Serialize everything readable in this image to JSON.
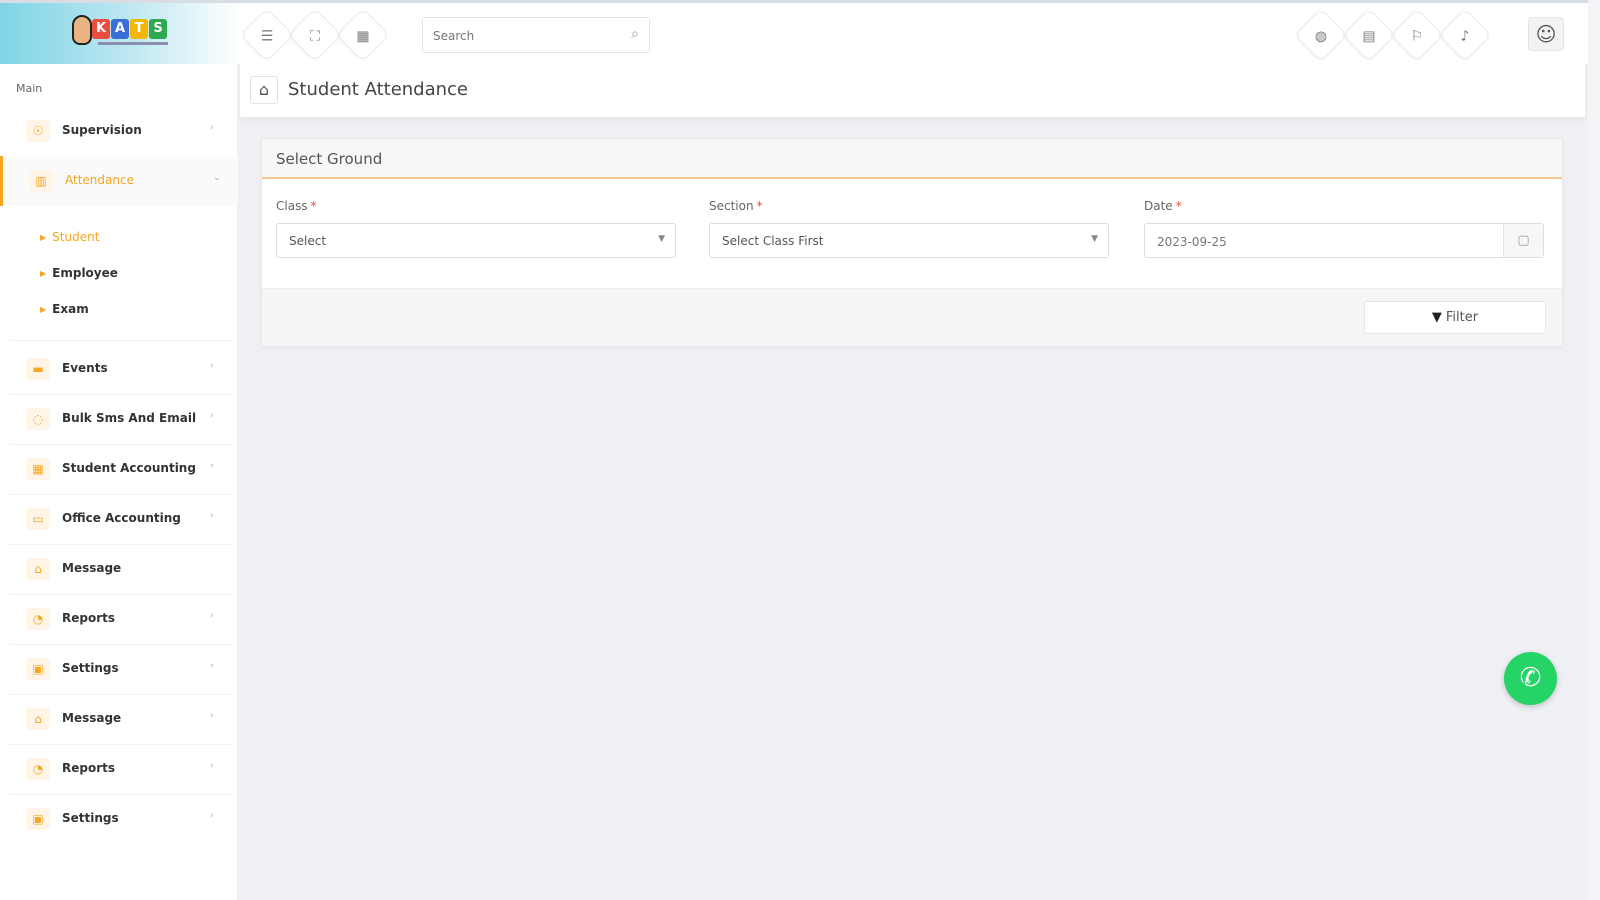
{
  "topbar": {
    "logo_letters": [
      "K",
      "A",
      "T",
      "S"
    ],
    "search_placeholder": "Search",
    "left_icons": [
      "menu-icon",
      "fullscreen-icon",
      "grid-icon"
    ],
    "right_icons": [
      "globe-icon",
      "calendar-icon",
      "flag-icon",
      "bell-icon"
    ],
    "avatar_icon": "user-icon"
  },
  "sidebar": {
    "heading": "Main",
    "items": [
      {
        "label": "Supervision",
        "icon": "supervision-icon",
        "arrow": "›"
      },
      {
        "label": "Attendance",
        "icon": "attendance-icon",
        "arrow": "⌄",
        "active": true,
        "children": [
          {
            "label": "Student",
            "active": true
          },
          {
            "label": "Employee"
          },
          {
            "label": "Exam"
          }
        ]
      },
      {
        "label": "Events",
        "icon": "events-icon",
        "arrow": "›"
      },
      {
        "label": "Bulk Sms And Email",
        "icon": "bell-icon",
        "arrow": "›"
      },
      {
        "label": "Student Accounting",
        "icon": "accounting-icon",
        "arrow": "›"
      },
      {
        "label": "Office Accounting",
        "icon": "office-icon",
        "arrow": "›"
      },
      {
        "label": "Message",
        "icon": "message-icon",
        "arrow": ""
      },
      {
        "label": "Reports",
        "icon": "reports-icon",
        "arrow": "›"
      },
      {
        "label": "Settings",
        "icon": "settings-icon",
        "arrow": "›"
      },
      {
        "label": "Message",
        "icon": "message-icon",
        "arrow": "›"
      },
      {
        "label": "Reports",
        "icon": "reports-icon",
        "arrow": "›"
      },
      {
        "label": "Settings",
        "icon": "settings-icon",
        "arrow": "›"
      }
    ]
  },
  "page": {
    "title": "Student Attendance"
  },
  "card": {
    "title": "Select Ground",
    "fields": {
      "class": {
        "label": "Class",
        "required": "*",
        "value": "Select"
      },
      "section": {
        "label": "Section",
        "required": "*",
        "value": "Select Class First"
      },
      "date": {
        "label": "Date",
        "required": "*",
        "value": "2023-09-25"
      }
    },
    "filter_label": "Filter"
  },
  "colors": {
    "accent": "#f5a623",
    "whatsapp": "#25d366",
    "brand_gradient_start": "#7fd4e6"
  }
}
